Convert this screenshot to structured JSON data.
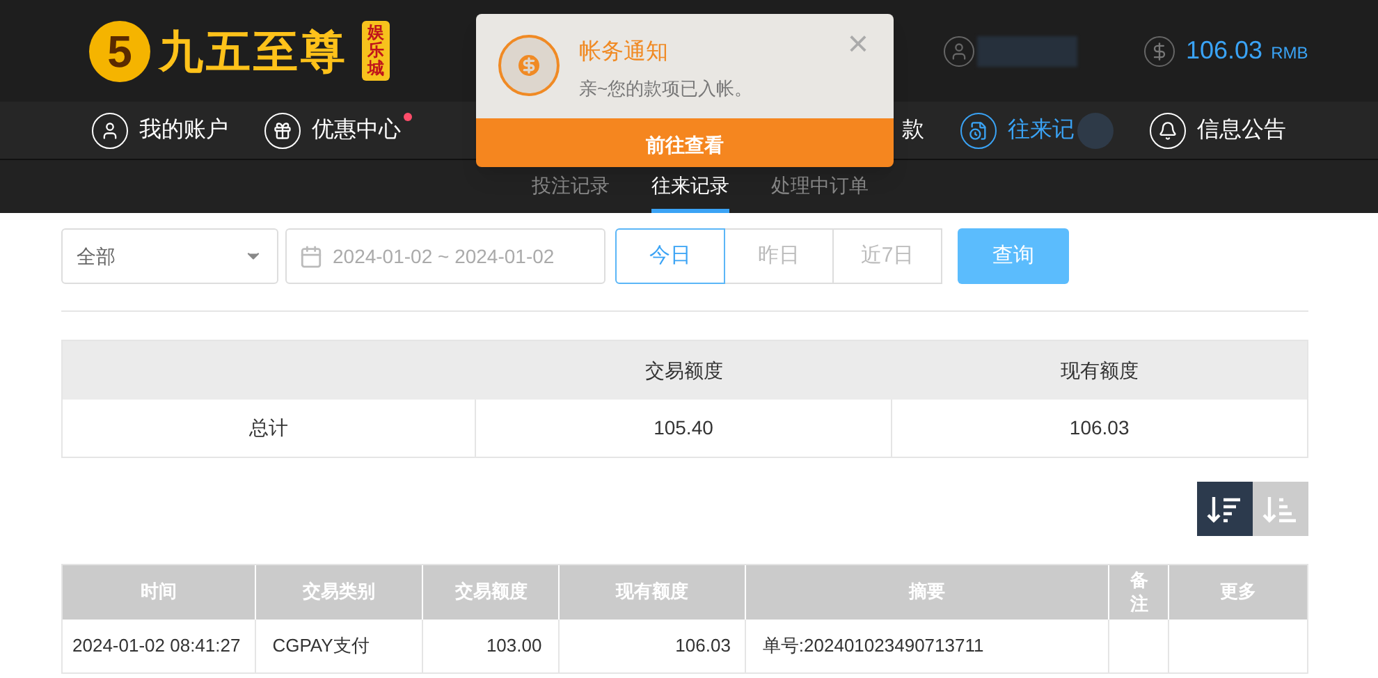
{
  "logo": {
    "mark": "5",
    "name": "九五至尊",
    "badge": "娱乐城"
  },
  "account": {
    "balance": "106.03",
    "currency": "RMB"
  },
  "nav": [
    {
      "label": "我的账户",
      "selected": false,
      "dot": false
    },
    {
      "label": "优惠中心",
      "selected": false,
      "dot": true
    },
    {
      "label": "款",
      "selected": false,
      "dot": false
    },
    {
      "label": "往来记",
      "selected": true,
      "dot": false
    },
    {
      "label": "信息公告",
      "selected": false,
      "dot": false
    }
  ],
  "subtabs": [
    {
      "label": "投注记录",
      "selected": false
    },
    {
      "label": "往来记录",
      "selected": true
    },
    {
      "label": "处理中订单",
      "selected": false
    }
  ],
  "filters": {
    "type_select": {
      "value": "全部"
    },
    "date_range": {
      "value": "2024-01-02 ~ 2024-01-02"
    },
    "quick_dates": [
      {
        "label": "今日",
        "selected": true
      },
      {
        "label": "昨日",
        "selected": false
      },
      {
        "label": "近7日",
        "selected": false
      }
    ],
    "query_button": "查询"
  },
  "summary": {
    "columns": [
      "交易额度",
      "现有额度"
    ],
    "row": {
      "label": "总计",
      "cells": [
        "105.40",
        "106.03"
      ]
    }
  },
  "sort_buttons": [
    {
      "selected": true
    },
    {
      "selected": false
    }
  ],
  "records": {
    "columns": [
      "时间",
      "交易类别",
      "交易额度",
      "现有额度",
      "摘要",
      "备注",
      "更多"
    ],
    "rows": [
      [
        "2024-01-02 08:41:27",
        "CGPAY支付",
        "103.00",
        "106.03",
        "单号:202401023490713711"
      ]
    ]
  },
  "notification": {
    "title": "帐务通知",
    "message": "亲~您的款项已入帐。",
    "close": "×",
    "action": "前往查看"
  }
}
